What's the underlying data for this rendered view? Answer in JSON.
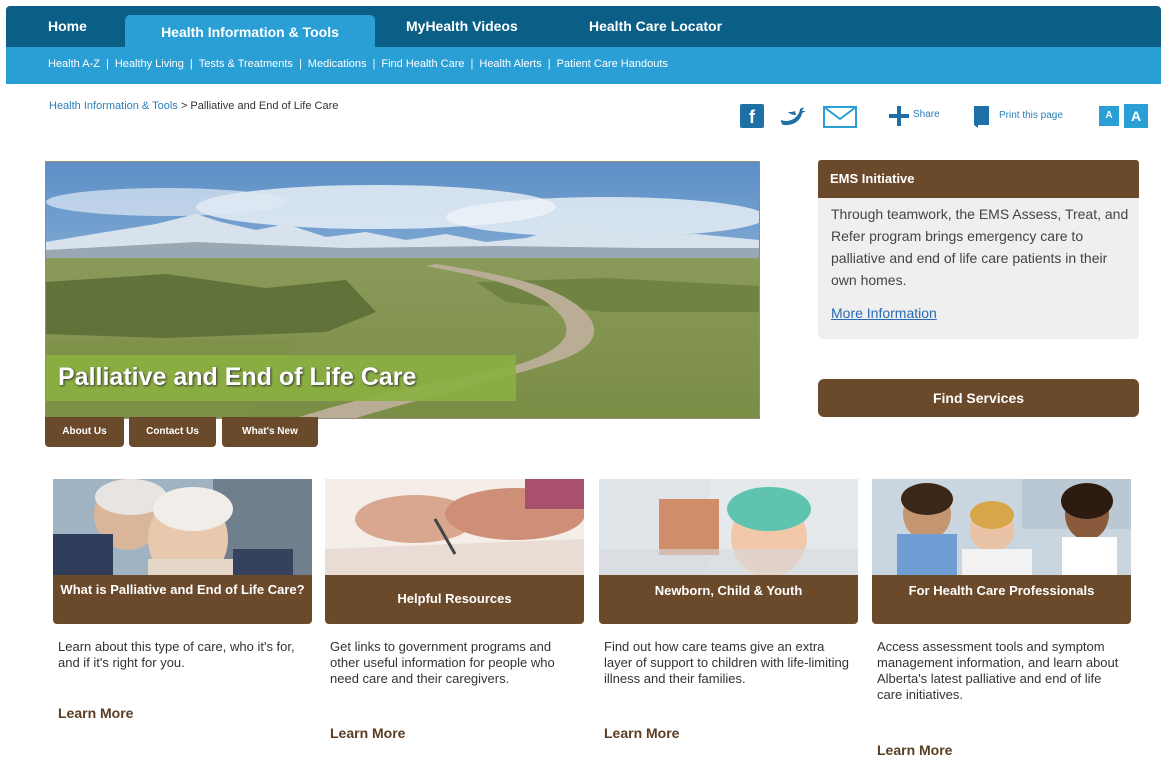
{
  "topnav": {
    "tabs": [
      {
        "label": "Home"
      },
      {
        "label": "Health Information & Tools"
      },
      {
        "label": "MyHealth Videos"
      },
      {
        "label": "Health Care Locator"
      }
    ]
  },
  "subnav": {
    "items": [
      "Health A-Z",
      "Healthy Living",
      "Tests & Treatments",
      "Medications",
      "Find Health Care",
      "Health Alerts",
      "Patient Care Handouts"
    ],
    "separator": "|"
  },
  "breadcrumb": {
    "parent": "Health Information & Tools",
    "arrow": ">",
    "current": "Palliative and End of Life Care"
  },
  "tools": {
    "facebook_glyph": "f",
    "share_label": "Share",
    "print_label": "Print this page",
    "font_small": "A",
    "font_large": "A"
  },
  "hero": {
    "title": "Palliative and End of Life Care",
    "tabs": [
      "About Us",
      "Contact Us",
      "What's New"
    ]
  },
  "ems": {
    "heading": "EMS Initiative",
    "body": "Through teamwork, the EMS Assess, Treat, and Refer program brings emergency care to palliative and end of life care patients in their own homes.",
    "link": "More Information"
  },
  "find_services": "Find Services",
  "cards": [
    {
      "title": "What is Palliative and End of Life Care?",
      "desc": "Learn about this type of care, who it's for, and if it's right for you.",
      "more": "Learn More"
    },
    {
      "title": "Helpful Resources",
      "desc": "Get links to government programs and other useful information for people who need care and their caregivers.",
      "more": "Learn More"
    },
    {
      "title": "Newborn, Child & Youth",
      "desc": "Find out how care teams give an extra layer of support to children with life-limiting illness and their families.",
      "more": "Learn More"
    },
    {
      "title": "For Health Care Professionals",
      "desc": "Access assessment tools and symptom management information, and learn about Alberta's latest palliative and end of life care initiatives.",
      "more": "Learn More"
    }
  ],
  "colors": {
    "nav_dark": "#0b5f86",
    "nav_light": "#2a9fd6",
    "brown": "#6b4a2c",
    "hero_green": "#8bb042",
    "link_blue": "#2a6ab3"
  }
}
